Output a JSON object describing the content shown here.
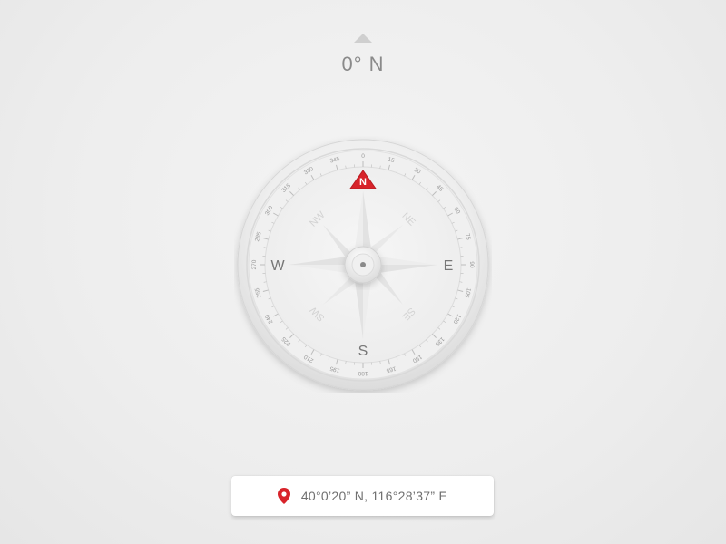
{
  "heading": {
    "value": "0° N",
    "indicator_icon": "triangle-up-icon"
  },
  "compass": {
    "heading_degrees": 0,
    "cardinals": {
      "n": "N",
      "e": "E",
      "s": "S",
      "w": "W"
    },
    "intercardinals": {
      "ne": "NE",
      "se": "SE",
      "sw": "SW",
      "nw": "NW"
    },
    "tick_labels": [
      "0",
      "15",
      "30",
      "45",
      "60",
      "75",
      "90",
      "105",
      "120",
      "135",
      "150",
      "165",
      "180",
      "195",
      "210",
      "225",
      "240",
      "255",
      "270",
      "285",
      "300",
      "315",
      "330",
      "345"
    ],
    "accent_color": "#d8232a"
  },
  "location": {
    "icon": "map-pin-icon",
    "coordinates": "40°0’20” N, 116°28’37” E"
  }
}
